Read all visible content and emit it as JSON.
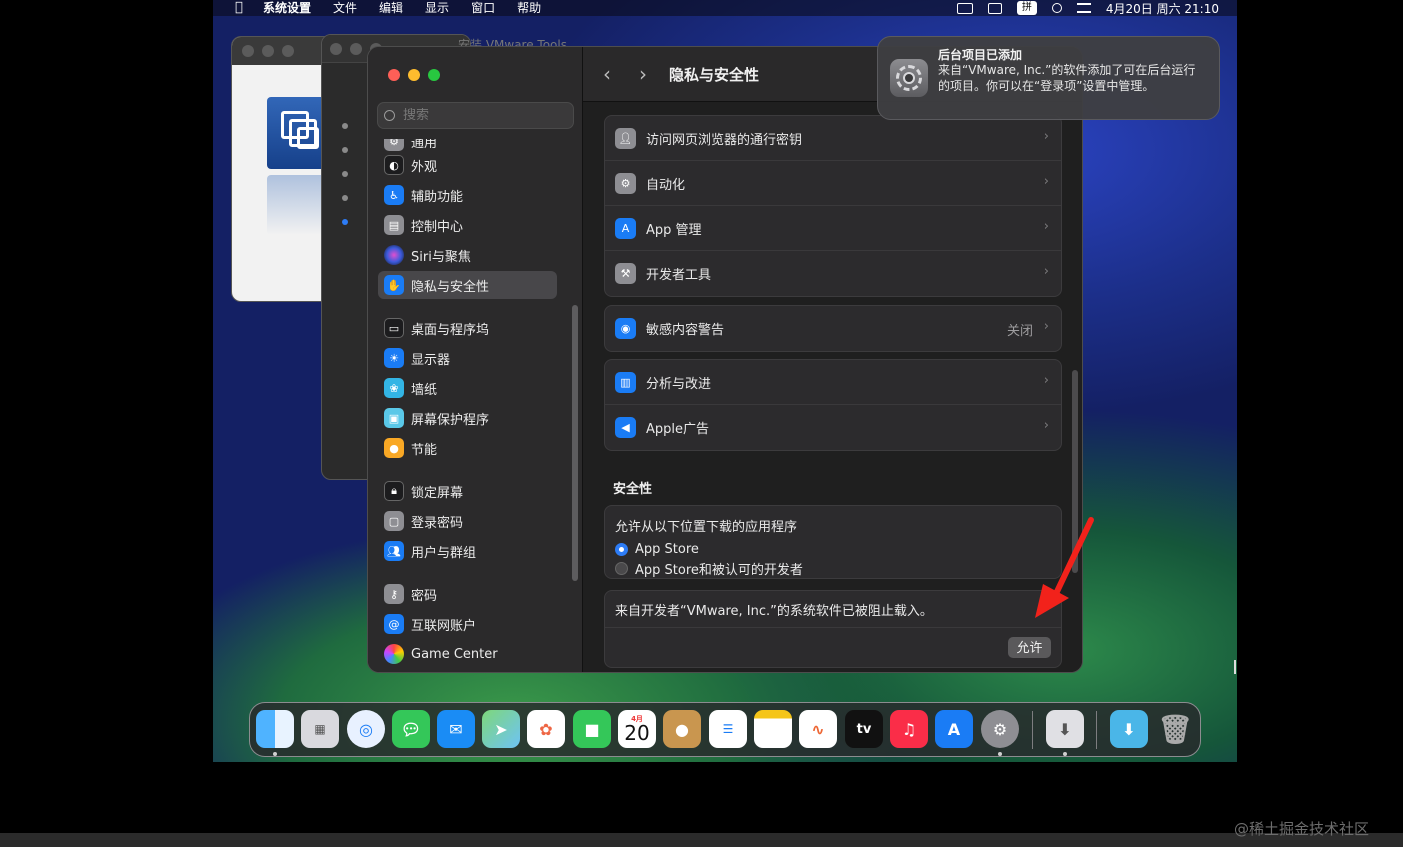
{
  "menubar": {
    "app_name": "系统设置",
    "items": [
      "文件",
      "编辑",
      "显示",
      "窗口",
      "帮助"
    ],
    "input_method": "拼",
    "datetime": "4月20日 周六 21:10"
  },
  "background_window": {
    "title": "安装 VMware Tools"
  },
  "sidebar": {
    "search_placeholder": "搜索",
    "partial_item": "通用",
    "items": [
      {
        "label": "外观",
        "icon": "appearance-icon",
        "color": "#1c1c1e"
      },
      {
        "label": "辅助功能",
        "icon": "accessibility-icon",
        "color": "#1a7cf5"
      },
      {
        "label": "控制中心",
        "icon": "control-center-icon",
        "color": "#8e8e93"
      },
      {
        "label": "Siri与聚焦",
        "icon": "siri-icon",
        "color": "#5b4bd6"
      },
      {
        "label": "隐私与安全性",
        "icon": "privacy-hand-icon",
        "color": "#1a7cf5",
        "selected": true
      },
      {
        "label": "桌面与程序坞",
        "icon": "dock-icon",
        "color": "#1c1c1e"
      },
      {
        "label": "显示器",
        "icon": "display-icon",
        "color": "#1a7cf5"
      },
      {
        "label": "墙纸",
        "icon": "wallpaper-icon",
        "color": "#33b5e5"
      },
      {
        "label": "屏幕保护程序",
        "icon": "screensaver-icon",
        "color": "#5ac8e8"
      },
      {
        "label": "节能",
        "icon": "energy-icon",
        "color": "#f9a825"
      },
      {
        "label": "锁定屏幕",
        "icon": "lock-screen-icon",
        "color": "#1c1c1e"
      },
      {
        "label": "登录密码",
        "icon": "login-password-icon",
        "color": "#8e8e93"
      },
      {
        "label": "用户与群组",
        "icon": "users-groups-icon",
        "color": "#1a7cf5"
      },
      {
        "label": "密码",
        "icon": "key-icon",
        "color": "#8e8e93"
      },
      {
        "label": "互联网账户",
        "icon": "internet-accounts-icon",
        "color": "#1a7cf5"
      },
      {
        "label": "Game Center",
        "icon": "game-center-icon",
        "color": "#f2f2f2"
      }
    ]
  },
  "content": {
    "title": "隐私与安全性",
    "group1": [
      {
        "label": "访问网页浏览器的通行密钥",
        "icon": "passkey-icon",
        "color": "#8e8e93"
      },
      {
        "label": "自动化",
        "icon": "automation-icon",
        "color": "#8e8e93"
      },
      {
        "label": "App 管理",
        "icon": "app-store-icon",
        "color": "#1a7cf5"
      },
      {
        "label": "开发者工具",
        "icon": "hammer-icon",
        "color": "#8e8e93"
      }
    ],
    "sensitive": {
      "label": "敏感内容警告",
      "value": "关闭",
      "icon": "eye-icon",
      "color": "#1a7cf5"
    },
    "group3": [
      {
        "label": "分析与改进",
        "icon": "analytics-icon",
        "color": "#1a7cf5"
      },
      {
        "label": "Apple广告",
        "icon": "megaphone-icon",
        "color": "#1a7cf5"
      }
    ],
    "security_heading": "安全性",
    "download_label": "允许从以下位置下载的应用程序",
    "radio_options": [
      {
        "label": "App Store",
        "selected": true
      },
      {
        "label": "App Store和被认可的开发者",
        "selected": false
      }
    ],
    "blocked_message": "来自开发者“VMware, Inc.”的系统软件已被阻止载入。",
    "allow_button": "允许"
  },
  "notification": {
    "title": "后台项目已添加",
    "body": "来自“VMware, Inc.”的软件添加了可在后台运行的项目。你可以在“登录项”设置中管理。"
  },
  "dock": {
    "calendar_month": "4月",
    "calendar_day": "20",
    "tv_label": "tv"
  },
  "watermark": "@稀土掘金技术社区"
}
